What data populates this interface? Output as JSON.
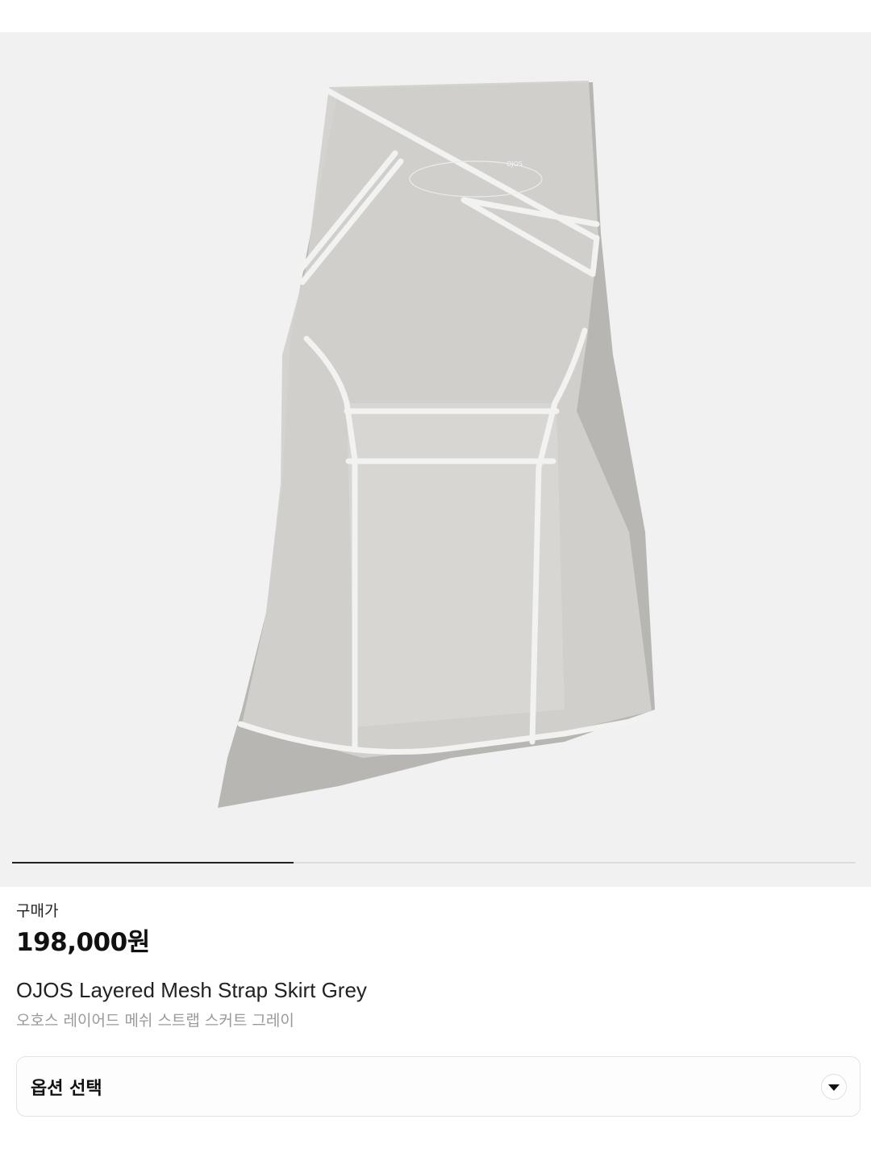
{
  "gallery": {
    "image_alt": "OJOS Layered Mesh Strap Skirt Grey product photo",
    "slide_index": 1,
    "slide_count": 3,
    "background": "#f1f1f1"
  },
  "product": {
    "price_label": "구매가",
    "price": "198,000원",
    "name": "OJOS Layered Mesh Strap Skirt Grey",
    "name_ko": "오호스 레이어드 메쉬 스트랩 스커트 그레이"
  },
  "option": {
    "label": "옵션 선택",
    "icon": "chevron-down-icon"
  }
}
